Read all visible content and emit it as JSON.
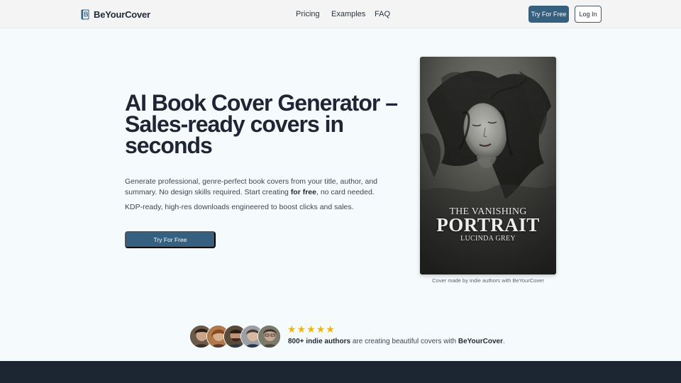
{
  "header": {
    "brand_name": "BeYourCover",
    "nav": [
      "Pricing",
      "Examples",
      "FAQ"
    ],
    "cta_label": "Try For Free",
    "login_label": "Log In"
  },
  "hero": {
    "title": "AI Book Cover Generator – Sales-ready covers in seconds",
    "desc_part1": "Generate professional, genre-perfect book covers from your title, author, and summary. No design skills required. Start creating ",
    "desc_bold": "for free",
    "desc_part2": ", no card needed.",
    "desc2": "KDP-ready, high-res downloads engineered to boost clicks and sales.",
    "cta_label": "Try For Free"
  },
  "cover": {
    "title_line1": "THE VANISHING",
    "title_line2": "PORTRAIT",
    "author": "LUCINDA GREY",
    "caption": "Cover made by indie authors with BeYourCover"
  },
  "proof": {
    "stars": [
      "★",
      "★",
      "★",
      "★",
      "★"
    ],
    "count_bold": "800+ indie authors",
    "text_mid": " are creating beautiful covers with ",
    "brand_bold": "BeYourCover",
    "text_end": "."
  },
  "colors": {
    "primary": "#35607f",
    "star": "#f5b400",
    "dark_band": "#1c2532"
  }
}
